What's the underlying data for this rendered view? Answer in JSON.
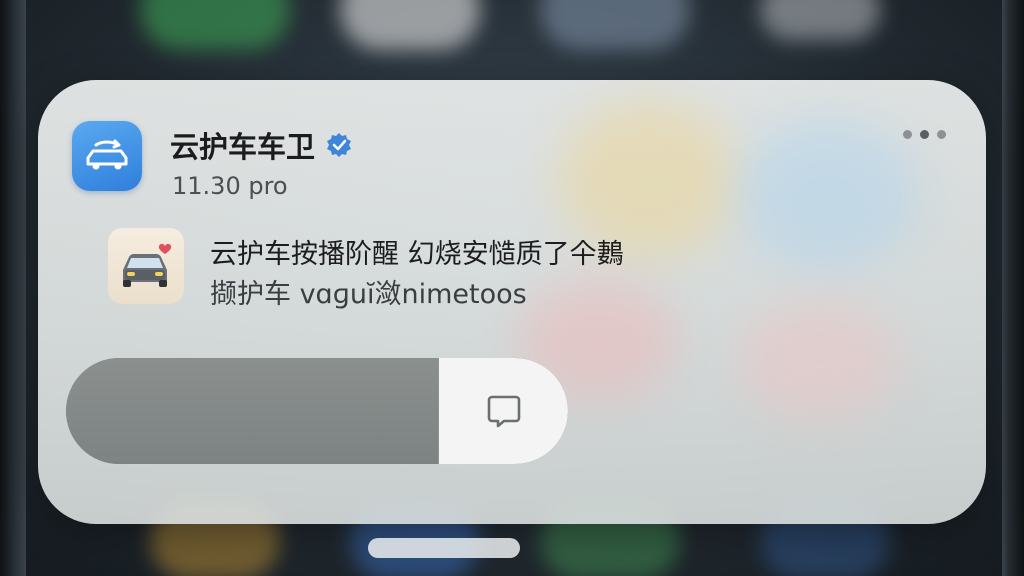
{
  "notification": {
    "app_name": "云护车车卫",
    "time": "11.30 pro",
    "message_line1": "云护车按播阶醒 幻烧安慥质了仐鶈",
    "message_line2": "撷护车 vɑɡuĭ潋nimetoos"
  },
  "icons": {
    "app": "car-sync-icon",
    "verified": "verified-badge-icon",
    "thumbnail": "car-heart-icon",
    "reply": "speech-bubble-icon",
    "more": "more-dots-icon"
  },
  "colors": {
    "app_icon": "#3a8ee6",
    "card": "#e6eae9",
    "action_dark": "#858a89",
    "action_light": "#f3f4f3"
  }
}
